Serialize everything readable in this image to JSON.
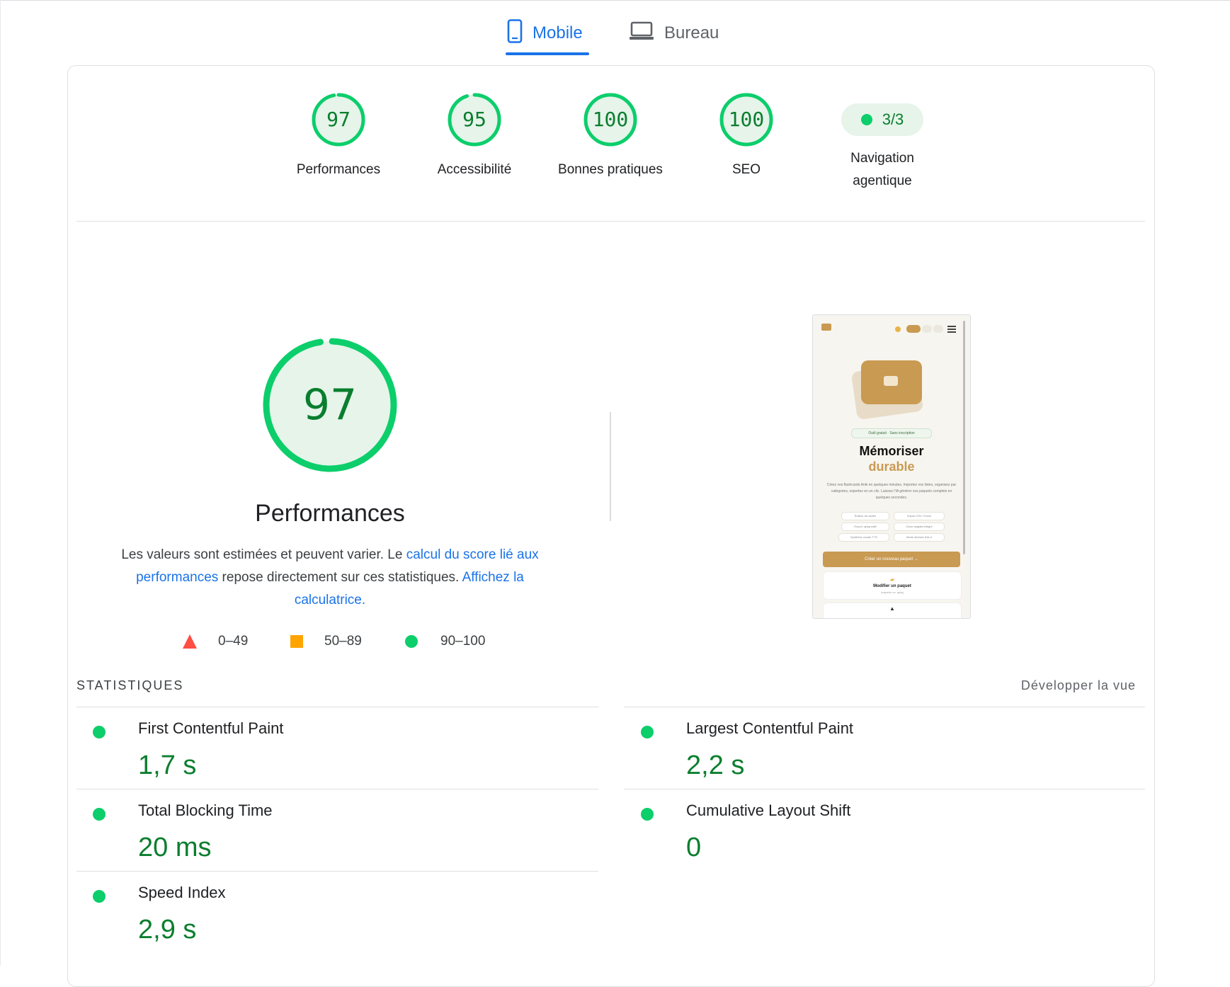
{
  "tabs": [
    {
      "label": "Mobile",
      "icon": "mobile-phone-icon",
      "active": true
    },
    {
      "label": "Bureau",
      "icon": "laptop-icon",
      "active": false
    }
  ],
  "categories": [
    {
      "score": "97",
      "label": "Performances"
    },
    {
      "score": "95",
      "label": "Accessibilité"
    },
    {
      "score": "100",
      "label": "Bonnes pratiques"
    },
    {
      "score": "100",
      "label": "SEO"
    }
  ],
  "agentic": {
    "value": "3/3",
    "label_line1": "Navigation",
    "label_line2": "agentique"
  },
  "performance": {
    "score": "97",
    "title": "Performances",
    "desc_text1": "Les valeurs sont estimées et peuvent varier. Le ",
    "desc_link1": "calcul du score lié aux performances",
    "desc_text2": " repose directement sur ces statistiques. ",
    "desc_link2": "Affichez la calculatrice."
  },
  "legend": [
    {
      "shape": "triangle",
      "color": "#ff4e42",
      "range": "0–49"
    },
    {
      "shape": "square",
      "color": "#ffa400",
      "range": "50–89"
    },
    {
      "shape": "circle",
      "color": "#0cce6b",
      "range": "90–100"
    }
  ],
  "screenshot": {
    "badge": "Outil gratuit · Sans inscription",
    "headline1": "Mémoriser",
    "headline2": "durable",
    "body": "Créez vos flashcards Anki en quelques minutes. Importez vos listes, organisez par catégories, exportez en un clic. Laissez l'IA générer vos paquets complets en quelques secondes.",
    "chips": [
      "Éditeur de cartes",
      "Import CSV / Excel",
      "Export .apkg natif",
      "Cloze anglais intégré",
      "Synthèse vocale TTS",
      "Mode devises IDA-4"
    ],
    "cta": "Créer un nouveau paquet  →",
    "card_title": "Modifier un paquet",
    "card_sub": "Importer un .apkg"
  },
  "statistics": {
    "heading": "STATISTIQUES",
    "expand_label": "Développer la vue",
    "metrics": [
      {
        "name": "First Contentful Paint",
        "value": "1,7 s"
      },
      {
        "name": "Largest Contentful Paint",
        "value": "2,2 s"
      },
      {
        "name": "Total Blocking Time",
        "value": "20 ms"
      },
      {
        "name": "Cumulative Layout Shift",
        "value": "0"
      },
      {
        "name": "Speed Index",
        "value": "2,9 s"
      }
    ]
  },
  "colors": {
    "pass": "#0cce6b",
    "pass_text": "#0a7e2e",
    "average": "#ffa400",
    "fail": "#ff4e42",
    "link": "#1a73e8"
  }
}
